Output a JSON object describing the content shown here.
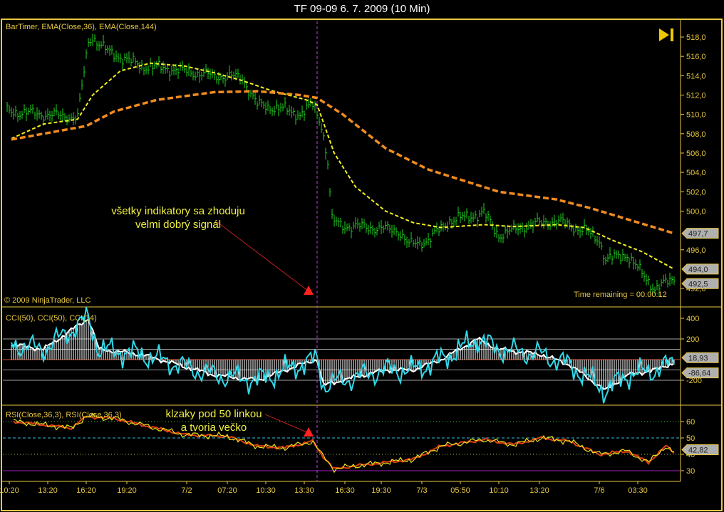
{
  "window": {
    "title": "TF 09-09  6. 7. 2009 (10 Min)"
  },
  "labels": {
    "price_panel": "BarTimer, EMA(Close,36), EMA(Close,144)",
    "copyright": "© 2009 NinjaTrader, LLC",
    "time_remaining": "Time remaining = 00:00:12",
    "cci_panel": "CCI(50), CCI(50), CCI(14)",
    "rsi_panel": "RSI(Close,36,3), RSI(Close,36,3)"
  },
  "annotations": {
    "price_line1": "všetky indikatory sa zhoduju",
    "price_line2": "velmi dobrý signál",
    "rsi_line1": "klzaky pod 50 linkou",
    "rsi_line2": "a tvoria  večko"
  },
  "colors": {
    "axis": "#e8c840",
    "price": "#20d020",
    "ema36": "#f0f020",
    "ema144": "#f08c20",
    "cci14": "#30d8e8",
    "cci_hist": "#ffffff",
    "rsi": "#f0e020",
    "rsi2": "#e04010",
    "marker": "#ff2020",
    "cursor": "#c040e0"
  },
  "chart_data": [
    {
      "type": "line",
      "title": "Price (10 Min)",
      "ylim": [
        491,
        519.5
      ],
      "yticks": [
        "518,0",
        "516,0",
        "514,0",
        "512,0",
        "510,0",
        "508,0",
        "506,0",
        "504,0",
        "502,0",
        "500,0",
        "496,0",
        "492,0"
      ],
      "ytick_values": [
        518,
        516,
        514,
        512,
        510,
        508,
        506,
        504,
        502,
        500,
        496,
        492
      ],
      "value_badges": [
        {
          "label": "497,7",
          "value": 497.7
        },
        {
          "label": "494,0",
          "value": 494.0
        },
        {
          "label": "492,5",
          "value": 492.5
        }
      ],
      "x_bars": 313,
      "series": [
        {
          "name": "Close",
          "points": [
            [
              2,
              510.3
            ],
            [
              17,
              510
            ],
            [
              33,
              509.7
            ],
            [
              38,
              517.5
            ],
            [
              40,
              518
            ],
            [
              47,
              516.5
            ],
            [
              63,
              515
            ],
            [
              73,
              514.8
            ],
            [
              97,
              514
            ],
            [
              110,
              513.8
            ],
            [
              117,
              511
            ],
            [
              130,
              510.5
            ],
            [
              137,
              510
            ],
            [
              143,
              511
            ],
            [
              147,
              509
            ],
            [
              150,
              505
            ],
            [
              152,
              499
            ],
            [
              157,
              498.5
            ],
            [
              170,
              498.3
            ],
            [
              183,
              498
            ],
            [
              188,
              496.5
            ],
            [
              197,
              497
            ],
            [
              207,
              499
            ],
            [
              223,
              499.8
            ],
            [
              230,
              497.5
            ],
            [
              243,
              498.5
            ],
            [
              257,
              499
            ],
            [
              270,
              498
            ],
            [
              277,
              497
            ],
            [
              280,
              495
            ],
            [
              290,
              495.5
            ],
            [
              297,
              493.5
            ],
            [
              303,
              492
            ],
            [
              312,
              493
            ]
          ]
        },
        {
          "name": "EMA(Close,36)",
          "points": [
            [
              2,
              507.5
            ],
            [
              17,
              509
            ],
            [
              33,
              509.5
            ],
            [
              40,
              512
            ],
            [
              53,
              514.5
            ],
            [
              67,
              515.3
            ],
            [
              83,
              515
            ],
            [
              97,
              514.3
            ],
            [
              110,
              513.5
            ],
            [
              123,
              512.5
            ],
            [
              140,
              511.5
            ],
            [
              145,
              511
            ],
            [
              153,
              506
            ],
            [
              163,
              502.5
            ],
            [
              177,
              500
            ],
            [
              190,
              498.8
            ],
            [
              203,
              498.3
            ],
            [
              223,
              498.6
            ],
            [
              237,
              498.4
            ],
            [
              257,
              498.6
            ],
            [
              270,
              498.3
            ],
            [
              283,
              497
            ],
            [
              297,
              495.8
            ],
            [
              312,
              494
            ]
          ]
        },
        {
          "name": "EMA(Close,144)",
          "points": [
            [
              2,
              507.4
            ],
            [
              17,
              508
            ],
            [
              37,
              508.8
            ],
            [
              50,
              510.3
            ],
            [
              70,
              511.5
            ],
            [
              97,
              512.3
            ],
            [
              117,
              512.4
            ],
            [
              137,
              512
            ],
            [
              145,
              511.7
            ],
            [
              157,
              510
            ],
            [
              177,
              506.5
            ],
            [
              197,
              504.3
            ],
            [
              230,
              502
            ],
            [
              257,
              501.2
            ],
            [
              273,
              500.3
            ],
            [
              297,
              498.7
            ],
            [
              312,
              497.7
            ]
          ]
        }
      ]
    },
    {
      "type": "bar",
      "title": "CCI",
      "ylim": [
        -330,
        460
      ],
      "yticks": [
        "400",
        "200",
        "-200"
      ],
      "ytick_values": [
        400,
        200,
        -200
      ],
      "levels": [
        200,
        100,
        0,
        -100,
        -200
      ],
      "value_badges": [
        {
          "label": "18,93",
          "value": 18.93
        },
        {
          "label": "-86,64",
          "value": -86.64
        }
      ],
      "series": [
        {
          "name": "CCI(50)",
          "points": [
            [
              2,
              150
            ],
            [
              17,
              100
            ],
            [
              38,
              400
            ],
            [
              43,
              100
            ],
            [
              63,
              50
            ],
            [
              80,
              -50
            ],
            [
              97,
              -150
            ],
            [
              117,
              -200
            ],
            [
              137,
              -50
            ],
            [
              145,
              0
            ],
            [
              148,
              -250
            ],
            [
              157,
              -200
            ],
            [
              177,
              -100
            ],
            [
              190,
              -100
            ],
            [
              203,
              0
            ],
            [
              220,
              200
            ],
            [
              230,
              100
            ],
            [
              250,
              50
            ],
            [
              263,
              -50
            ],
            [
              280,
              -300
            ],
            [
              290,
              -150
            ],
            [
              303,
              -100
            ],
            [
              312,
              -30
            ]
          ]
        }
      ]
    },
    {
      "type": "line",
      "title": "RSI",
      "ylim": [
        26,
        70
      ],
      "yticks": [
        "60",
        "50",
        "40",
        "30"
      ],
      "ytick_values": [
        60,
        50,
        40,
        30
      ],
      "levels": [
        60,
        50,
        40,
        30
      ],
      "value_badges": [
        {
          "label": "42,82",
          "value": 42.82
        }
      ],
      "series": [
        {
          "name": "RSI(Close,36,3)",
          "points": [
            [
              3,
              60
            ],
            [
              17,
              58
            ],
            [
              30,
              56
            ],
            [
              37,
              63
            ],
            [
              50,
              62
            ],
            [
              63,
              58
            ],
            [
              83,
              52
            ],
            [
              103,
              51
            ],
            [
              117,
              45
            ],
            [
              130,
              44
            ],
            [
              143,
              48
            ],
            [
              147,
              40
            ],
            [
              153,
              31
            ],
            [
              163,
              33
            ],
            [
              177,
              35
            ],
            [
              190,
              37
            ],
            [
              203,
              45
            ],
            [
              223,
              49
            ],
            [
              237,
              46
            ],
            [
              250,
              50
            ],
            [
              263,
              48
            ],
            [
              277,
              40
            ],
            [
              290,
              42
            ],
            [
              300,
              35
            ],
            [
              308,
              45
            ],
            [
              312,
              41
            ]
          ]
        }
      ]
    }
  ],
  "x_axis": {
    "ticks": [
      {
        "label": "10:20",
        "bar": 1
      },
      {
        "label": "13:20",
        "bar": 19
      },
      {
        "label": "16:20",
        "bar": 37
      },
      {
        "label": "19:20",
        "bar": 56
      },
      {
        "label": "7/2",
        "bar": 84
      },
      {
        "label": "07:20",
        "bar": 103
      },
      {
        "label": "10:30",
        "bar": 121
      },
      {
        "label": "13:30",
        "bar": 139
      },
      {
        "label": "16:30",
        "bar": 158
      },
      {
        "label": "19:30",
        "bar": 175
      },
      {
        "label": "7/3",
        "bar": 194
      },
      {
        "label": "05:50",
        "bar": 212
      },
      {
        "label": "10:10",
        "bar": 230
      },
      {
        "label": "13:20",
        "bar": 249
      },
      {
        "label": "7/6",
        "bar": 277
      },
      {
        "label": "03:30",
        "bar": 295
      }
    ],
    "cursor_bar": 145
  }
}
